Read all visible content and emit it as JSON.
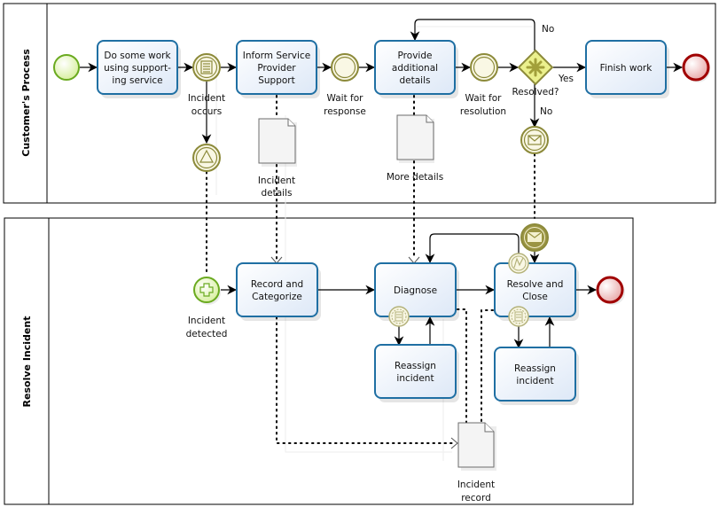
{
  "diagram": {
    "type": "BPMN process diagram",
    "lanes": [
      {
        "id": "customer",
        "title": "Customer's Process"
      },
      {
        "id": "resolve",
        "title": "Resolve Incident"
      }
    ],
    "tasks": {
      "do_work": "Do some work using support-ing service",
      "do_work_lines": [
        "Do some work",
        "using support-",
        "ing service"
      ],
      "inform_lines": [
        "Inform Service",
        "Provider",
        "Support"
      ],
      "provide_lines": [
        "Provide",
        "additional",
        "details"
      ],
      "finish_lines": [
        "Finish work"
      ],
      "record_lines": [
        "Record and",
        "Categorize"
      ],
      "diagnose_lines": [
        "Diagnose"
      ],
      "resolve_close_lines": [
        "Resolve and",
        "Close"
      ],
      "reassign1_lines": [
        "Reassign",
        "incident"
      ],
      "reassign2_lines": [
        "Reassign",
        "incident"
      ]
    },
    "events": {
      "incident_occurs": [
        "Incident",
        "occurs"
      ],
      "wait_response": [
        "Wait for",
        "response"
      ],
      "wait_resolution": [
        "Wait for",
        "resolution"
      ],
      "incident_detected": [
        "Incident",
        "detected"
      ]
    },
    "gateway": {
      "label": "Resolved?",
      "yes": "Yes",
      "no_top": "No",
      "no_bottom": "No"
    },
    "data_objects": {
      "incident_details": [
        "Incident",
        "details"
      ],
      "more_details": [
        "More details"
      ],
      "incident_record": [
        "Incident",
        "record"
      ]
    }
  }
}
